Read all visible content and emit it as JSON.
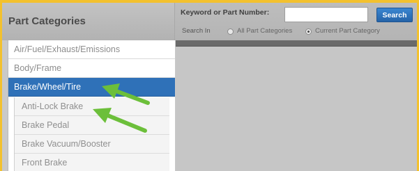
{
  "left_panel": {
    "title": "Part Categories",
    "categories": [
      {
        "label": "Air/Fuel/Exhaust/Emissions",
        "selected": false
      },
      {
        "label": "Body/Frame",
        "selected": false
      },
      {
        "label": "Brake/Wheel/Tire",
        "selected": true
      }
    ],
    "subcategories": [
      {
        "label": "Anti-Lock Brake"
      },
      {
        "label": "Brake Pedal"
      },
      {
        "label": "Brake Vacuum/Booster"
      },
      {
        "label": "Front Brake"
      }
    ]
  },
  "search": {
    "keyword_label": "Keyword or Part Number:",
    "keyword_value": "",
    "search_button_label": "Search",
    "search_in_label": "Search In",
    "options": [
      {
        "label": "All Part Categories",
        "checked": false
      },
      {
        "label": "Current Part Category",
        "checked": true
      }
    ]
  },
  "colors": {
    "page_background": "#f3c12e",
    "selected_category": "#2f71b8",
    "search_button": "#2e74bd",
    "annotation_arrow": "#6cbf3a"
  },
  "annotations": [
    {
      "type": "arrow",
      "icon": "green-arrow-icon",
      "target": "Brake/Wheel/Tire"
    },
    {
      "type": "arrow",
      "icon": "green-arrow-icon",
      "target": "Anti-Lock Brake"
    }
  ]
}
